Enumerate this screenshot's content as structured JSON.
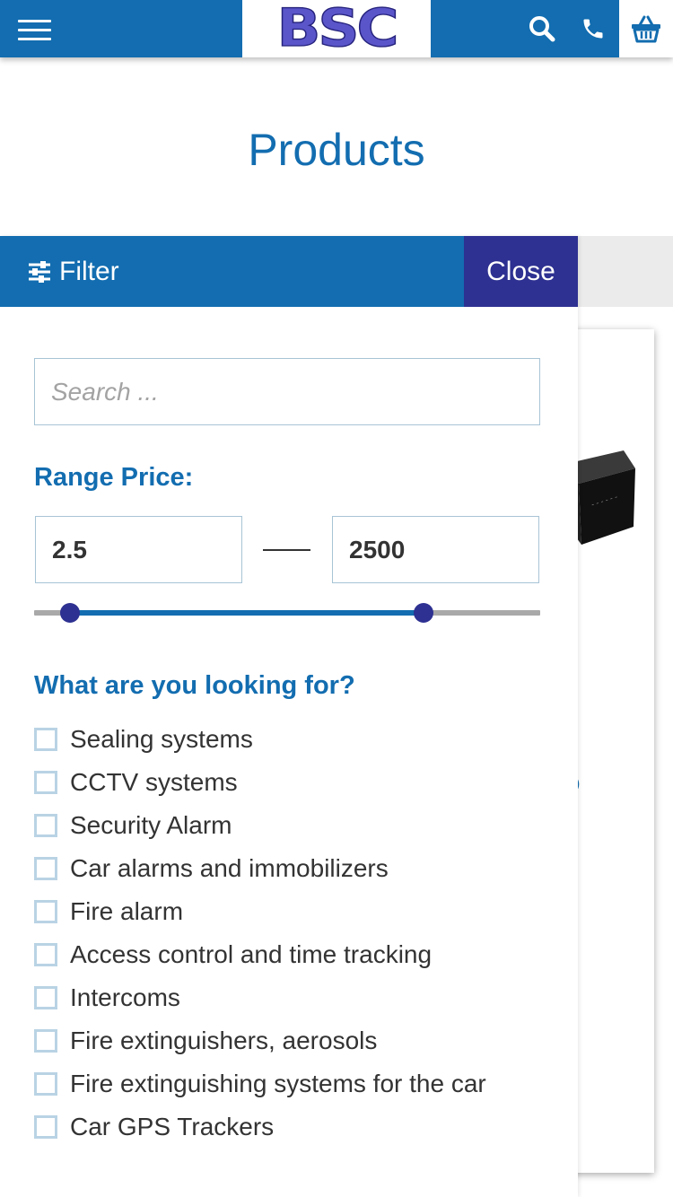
{
  "header": {
    "logo": "BSC",
    "icons": [
      "menu-icon",
      "search-icon",
      "phone-icon",
      "basket-icon"
    ],
    "colors": {
      "primary": "#136db0",
      "accent": "#2e3191"
    }
  },
  "page": {
    "title": "Products"
  },
  "filter": {
    "title": "Filter",
    "close_label": "Close",
    "search_placeholder": "Search ...",
    "price_title": "Range Price:",
    "price_min": "2.5",
    "price_max": "2500",
    "categories_title": "What are you looking for?",
    "categories": [
      "Sealing systems",
      "CCTV systems",
      "Security Alarm",
      "Car alarms and immobilizers",
      "Fire alarm",
      "Access control and time tracking",
      "Intercoms",
      "Fire extinguishers, aerosols",
      "Fire extinguishing systems for the car",
      "Car GPS Trackers"
    ]
  },
  "background_product": {
    "price_fragment": "5"
  }
}
